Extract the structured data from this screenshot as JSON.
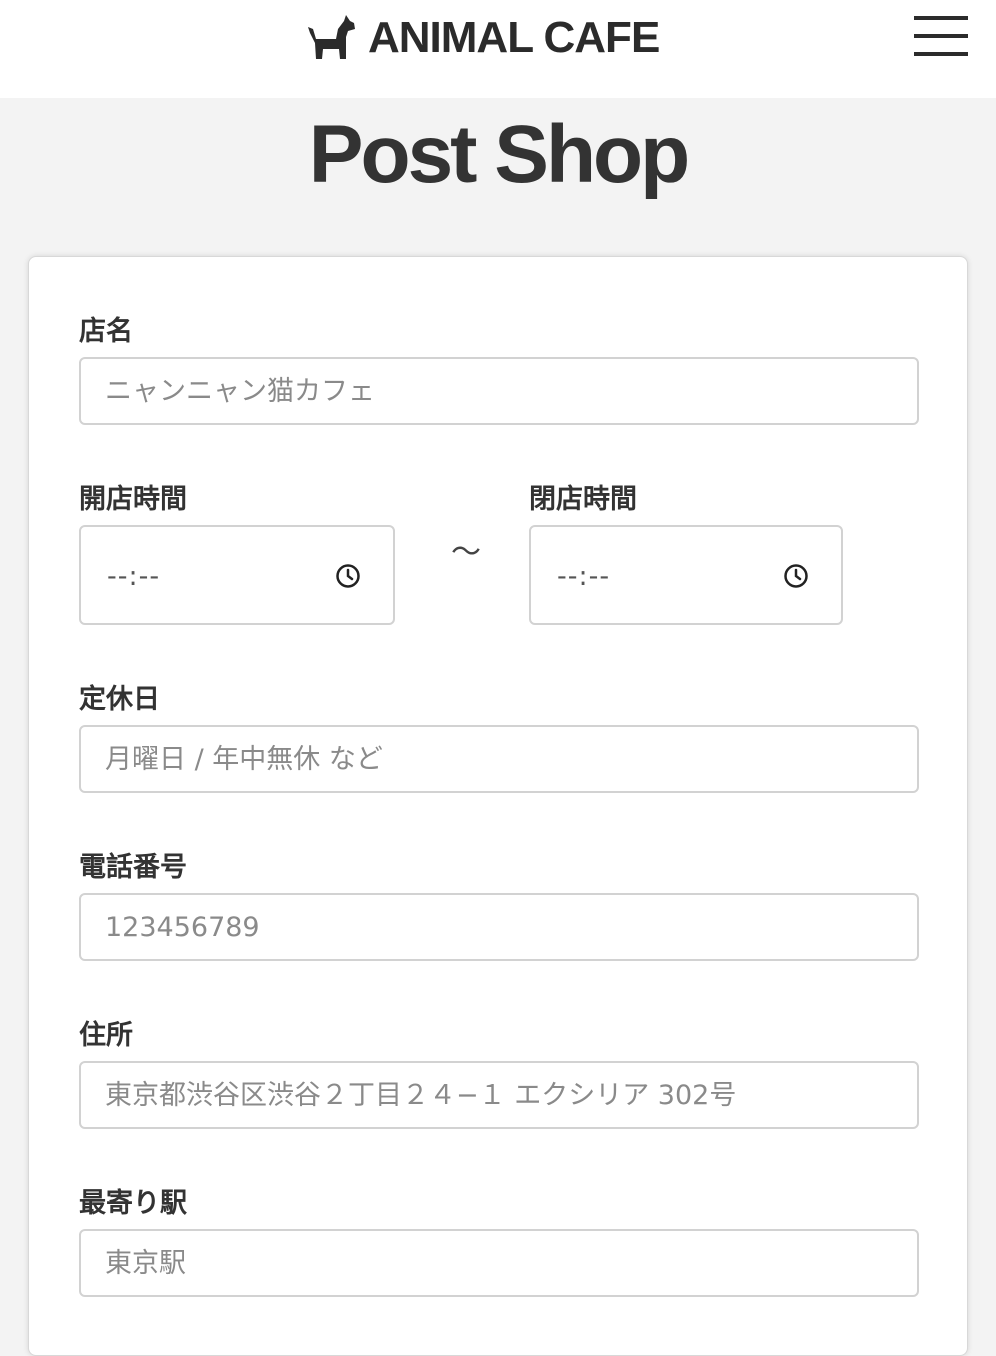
{
  "header": {
    "brand": "ANIMAL CAFE",
    "logo_icon": "dog-icon",
    "menu_icon": "hamburger-menu-icon"
  },
  "page": {
    "title": "Post Shop"
  },
  "form": {
    "shop_name": {
      "label": "店名",
      "placeholder": "ニャンニャン猫カフェ",
      "value": ""
    },
    "open_time": {
      "label": "開店時間",
      "value": "--:--",
      "icon": "clock-icon"
    },
    "separator": "〜",
    "close_time": {
      "label": "閉店時間",
      "value": "--:--",
      "icon": "clock-icon"
    },
    "holiday": {
      "label": "定休日",
      "placeholder": "月曜日 / 年中無休 など",
      "value": ""
    },
    "phone": {
      "label": "電話番号",
      "placeholder": "123456789",
      "value": ""
    },
    "address": {
      "label": "住所",
      "placeholder": "東京都渋谷区渋谷２丁目２４−１ エクシリア 302号",
      "value": ""
    },
    "station": {
      "label": "最寄り駅",
      "placeholder": "東京駅",
      "value": ""
    }
  },
  "colors": {
    "background": "#f3f3f3",
    "text": "#333333",
    "border": "#d2d2d2",
    "placeholder": "#8a8a8a"
  }
}
